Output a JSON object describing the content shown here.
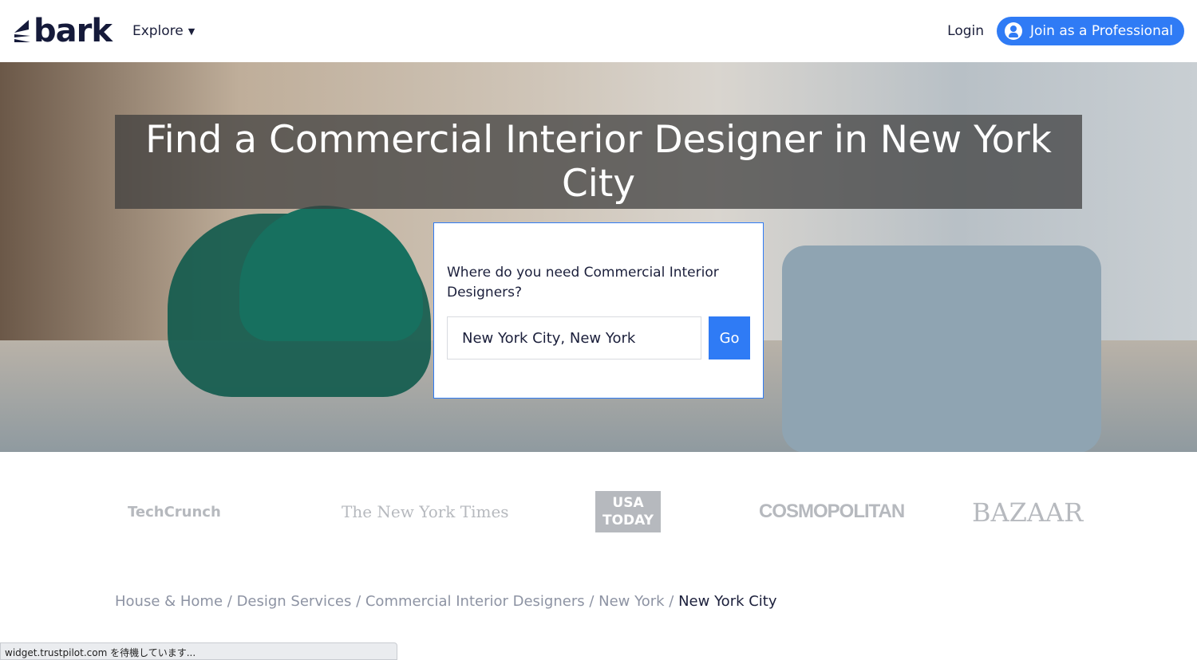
{
  "nav": {
    "logo": "bark",
    "explore": "Explore",
    "login": "Login",
    "join": "Join as a Professional"
  },
  "hero": {
    "title": "Find a Commercial Interior Designer in New York City"
  },
  "search": {
    "question": "Where do you need Commercial Interior Designers?",
    "location_value": "New York City, New York",
    "go": "Go"
  },
  "press": [
    "TechCrunch",
    "The New York Times",
    "USA TODAY",
    "COSMOPOLITAN",
    "BAZAAR"
  ],
  "breadcrumb": [
    {
      "label": "House & Home"
    },
    {
      "label": "Design Services"
    },
    {
      "label": "Commercial Interior Designers"
    },
    {
      "label": "New York"
    },
    {
      "label": "New York City"
    }
  ],
  "status_bar": "widget.trustpilot.com を待機しています...",
  "colors": {
    "accent": "#2f7bf5",
    "brand_dark": "#151a3a"
  }
}
